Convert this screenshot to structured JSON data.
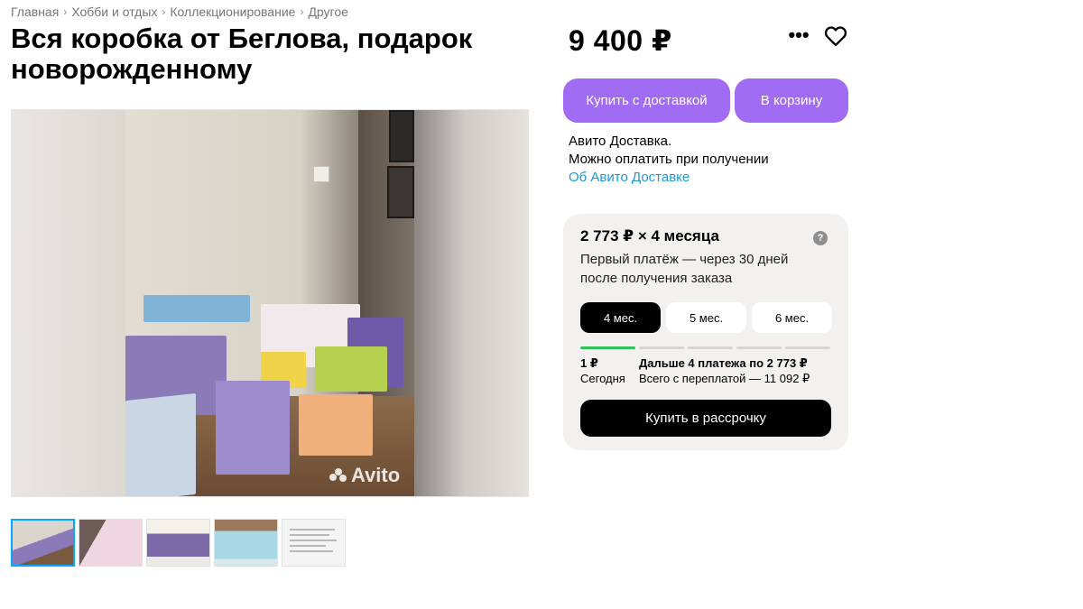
{
  "breadcrumb": [
    "Главная",
    "Хобби и отдых",
    "Коллекционирование",
    "Другое"
  ],
  "title": "Вся коробка от Беглова, подарок новорожденному",
  "price": "9 400 ₽",
  "icons": {
    "more": "more-dots-icon",
    "favorite": "heart-icon"
  },
  "gallery": {
    "watermark": "Avito",
    "thumbnail_count": 5,
    "active_thumbnail": 1
  },
  "actions": {
    "buy_with_delivery": "Купить с доставкой",
    "add_to_cart": "В корзину"
  },
  "delivery": {
    "line1": "Авито Доставка.",
    "line2": "Можно оплатить при получении",
    "link": "Об Авито Доставке"
  },
  "installment": {
    "heading": "2 773 ₽ × 4 месяца",
    "help": "?",
    "description": "Первый платёж — через 30 дней после получения заказа",
    "terms": [
      "4 мес.",
      "5 мес.",
      "6 мес."
    ],
    "selected_term": 0,
    "first_payment_amount": "1 ₽",
    "first_payment_when": "Сегодня",
    "next_payments": "Дальше 4 платежа по 2 773 ₽",
    "total": "Всего с переплатой — 11 092 ₽",
    "button": "Купить в рассрочку"
  },
  "colors": {
    "accent_purple": "#a06cf3",
    "link_blue": "#1a98d5",
    "progress_green": "#2fc25b",
    "card_bg": "#f2f1f0"
  }
}
